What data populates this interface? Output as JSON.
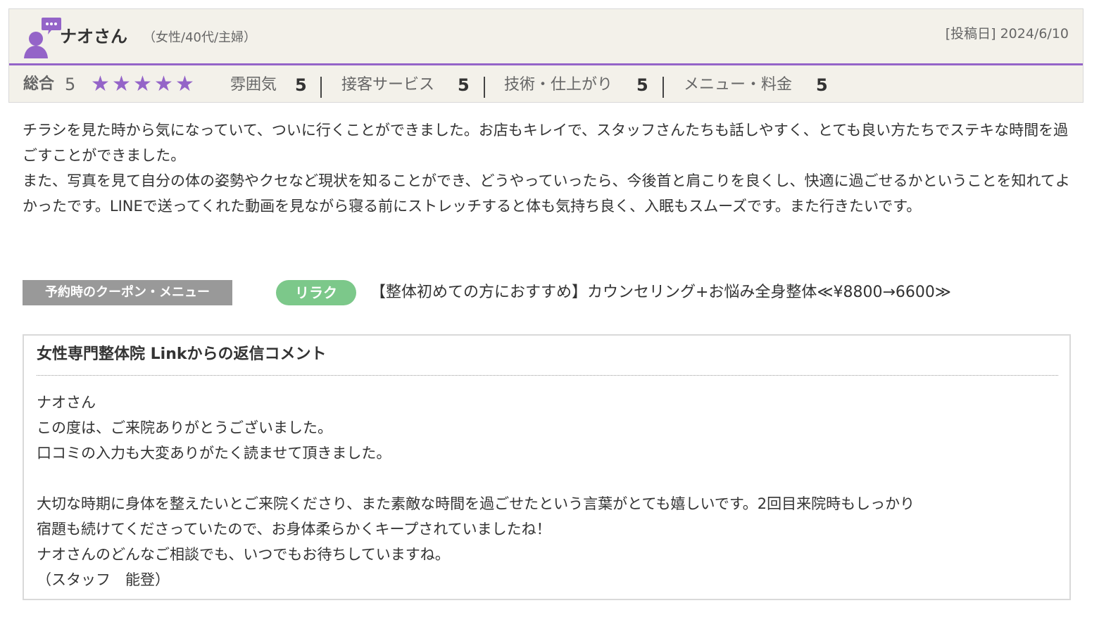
{
  "reviewer": {
    "name": "ナオさん",
    "meta": "（女性/40代/主婦）",
    "date": "[投稿日] 2024/6/10"
  },
  "ratings": {
    "overall_label": "総合",
    "overall_value": "5",
    "stars": 5,
    "items": [
      {
        "label": "雰囲気",
        "value": "5"
      },
      {
        "label": "接客サービス",
        "value": "5"
      },
      {
        "label": "技術・仕上がり",
        "value": "5"
      },
      {
        "label": "メニュー・料金",
        "value": "5"
      }
    ]
  },
  "review": {
    "paragraphs": [
      "チラシを見た時から気になっていて、ついに行くことができました。お店もキレイで、スタッフさんたちも話しやすく、とても良い方たちでステキな時間を過ごすことができました。",
      "また、写真を見て自分の体の姿勢やクセなど現状を知ることができ、どうやっていったら、今後首と肩こりを良くし、快適に過ごせるかということを知れてよかったです。LINEで送ってくれた動画を見ながら寝る前にストレッチすると体も気持ち良く、入眠もスムーズです。また行きたいです。"
    ]
  },
  "coupon": {
    "label": "予約時のクーポン・メニュー",
    "badge": "リラク",
    "title": "【整体初めての方におすすめ】カウンセリング+お悩み全身整体≪¥8800→6600≫"
  },
  "reply": {
    "title": "女性専門整体院 Linkからの返信コメント",
    "lines": [
      "ナオさん",
      "この度は、ご来院ありがとうございました。",
      "口コミの入力も大変ありがたく読ませて頂きました。",
      "",
      "大切な時期に身体を整えたいとご来院くださり、また素敵な時間を過ごせたという言葉がとても嬉しいです。2回目来院時もしっかり",
      "宿題も続けてくださっていたので、お身体柔らかくキープされていましたね！",
      "ナオさんのどんなご相談でも、いつでもお待ちしていますね。",
      "（スタッフ　能登）"
    ]
  },
  "colors": {
    "accent": "#9464c8",
    "badge": "#7cc88a",
    "card_bg": "#f3f1ea",
    "coupon_label_bg": "#999999"
  },
  "icons": {
    "avatar": "user-comment-icon",
    "star": "star-icon"
  }
}
